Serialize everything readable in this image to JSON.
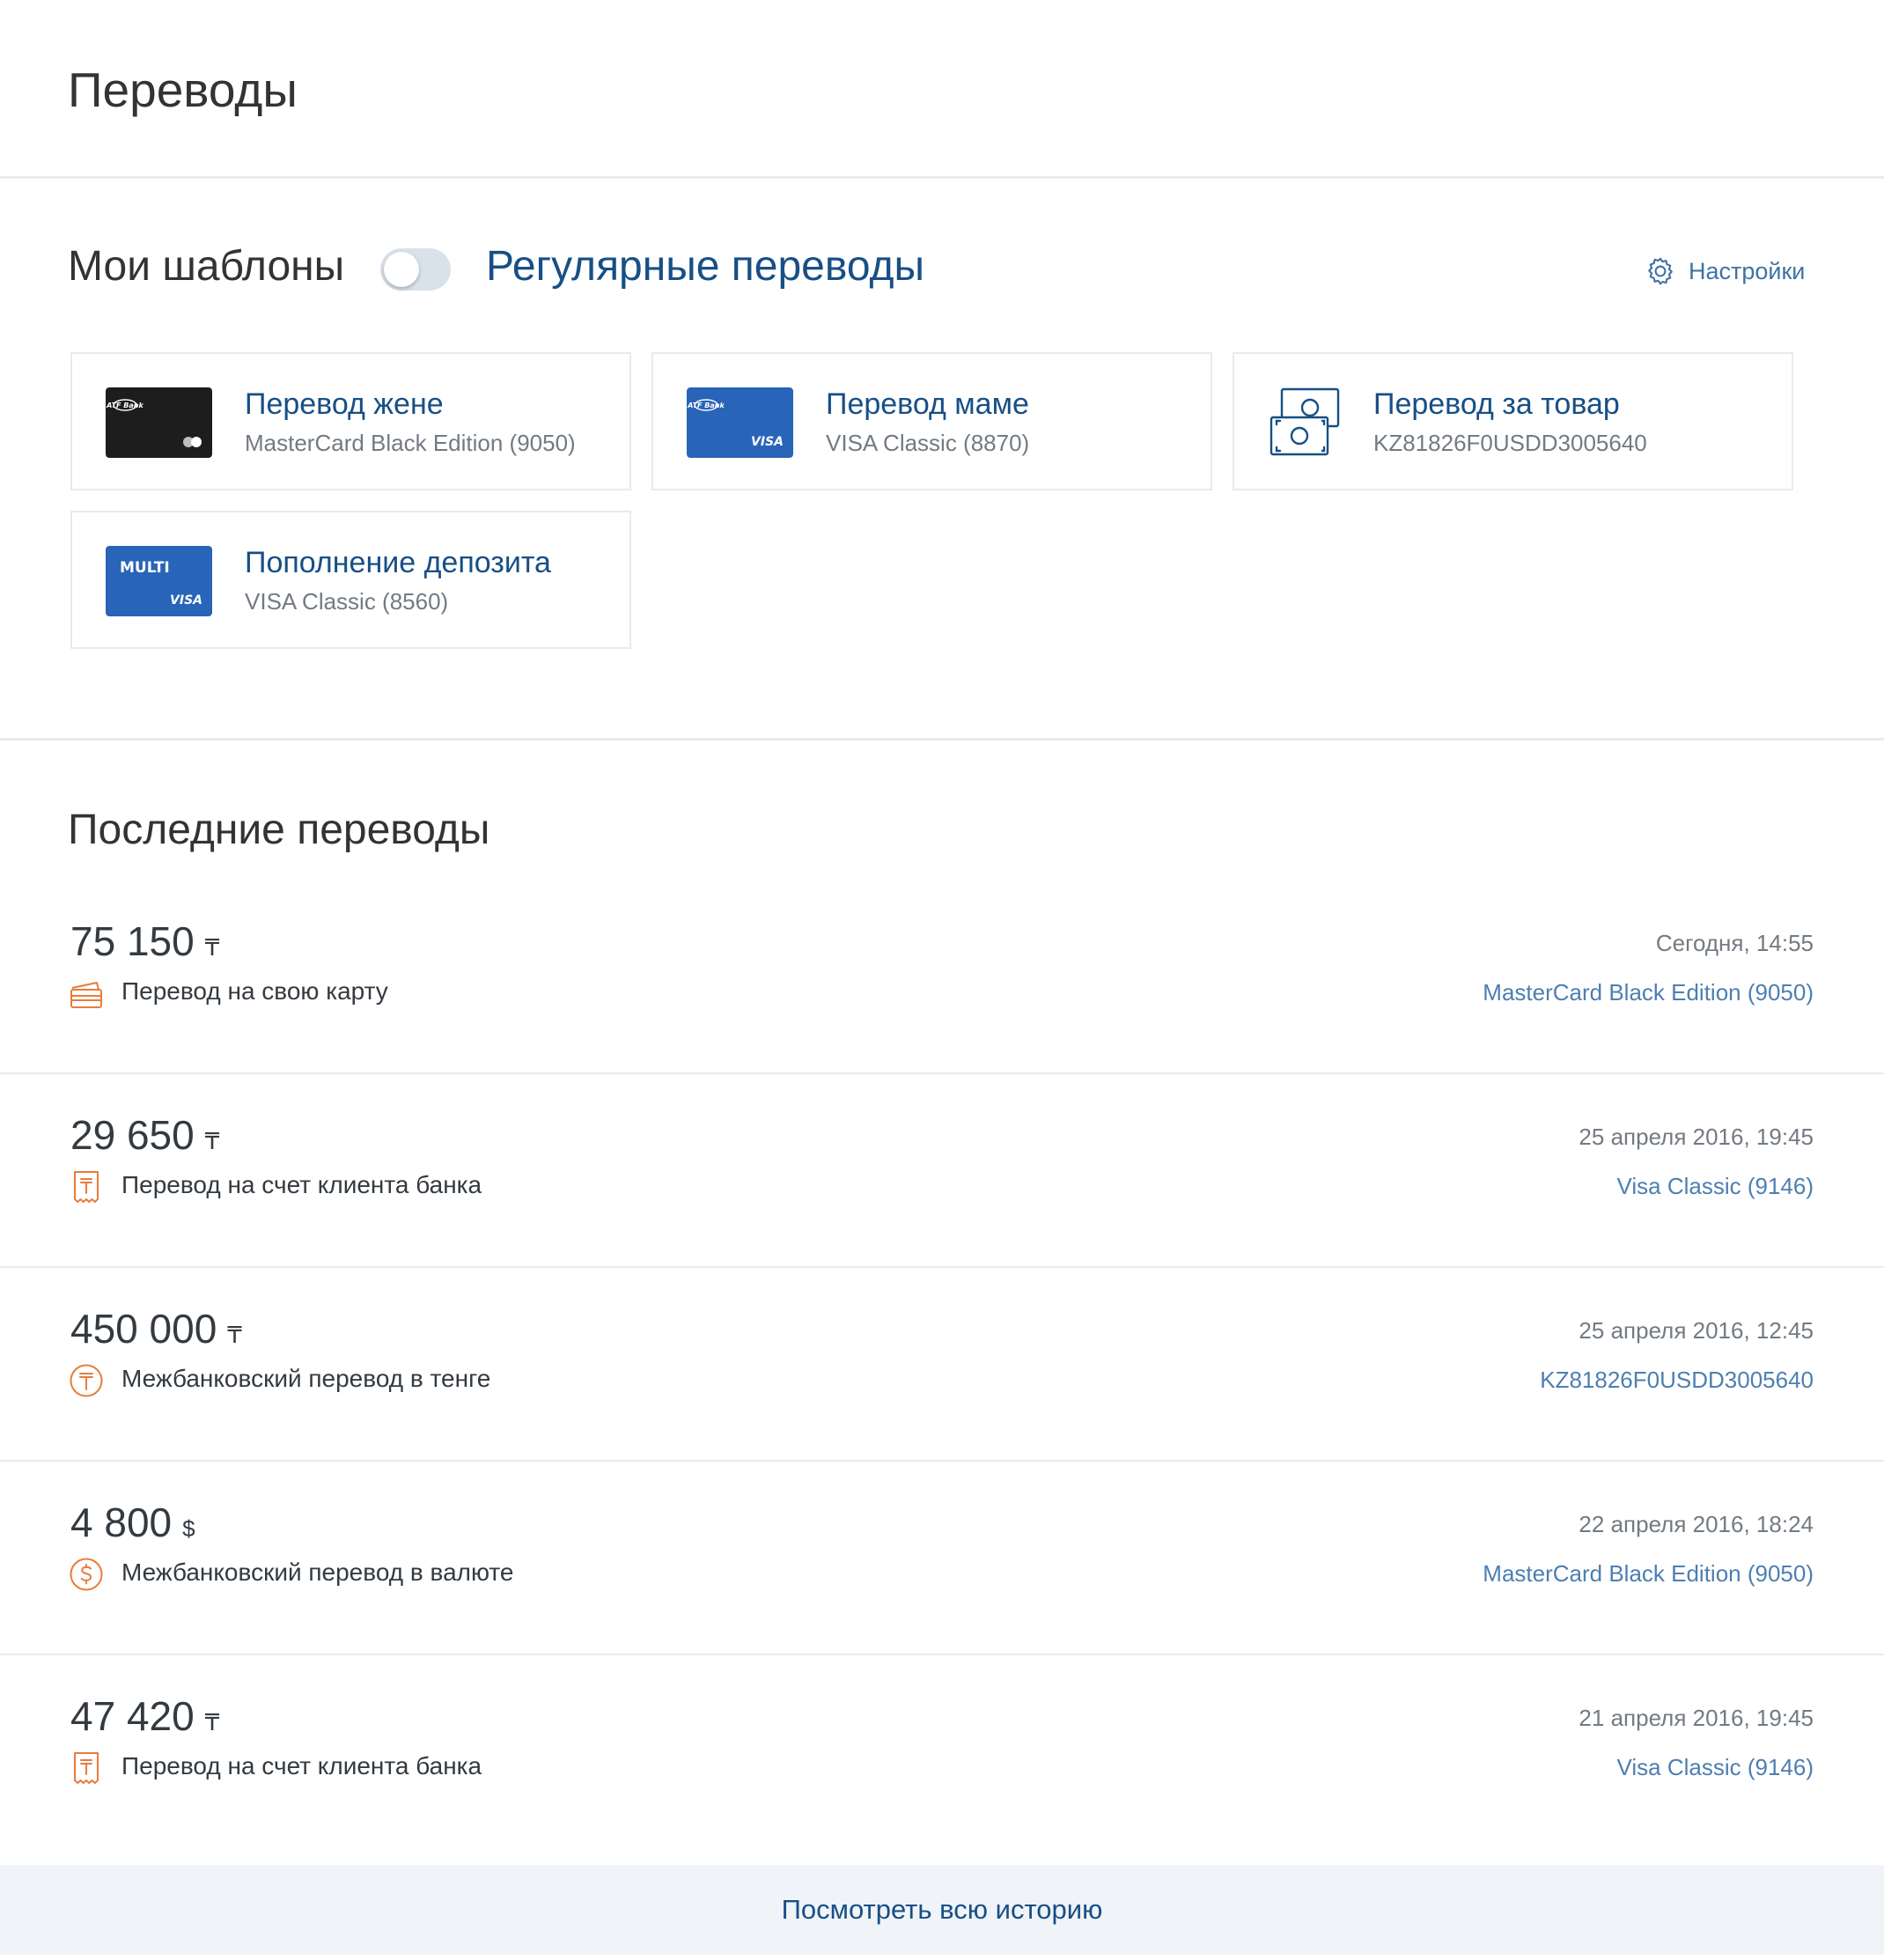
{
  "header": {
    "title": "Переводы"
  },
  "templates": {
    "my_templates_label": "Мои шаблоны",
    "regular_transfers_label": "Регулярные переводы",
    "settings_label": "Настройки",
    "toggle_on": false,
    "items": [
      {
        "title": "Перевод жене",
        "subtitle": "MasterCard Black Edition (9050)",
        "thumb": "atf-black-card",
        "thumb_brand": "ATF Bank"
      },
      {
        "title": "Перевод маме",
        "subtitle": "VISA Classic (8870)",
        "thumb": "atf-visa-card",
        "thumb_brand": "ATF Bank",
        "thumb_network": "VISA"
      },
      {
        "title": "Перевод за товар",
        "subtitle": "KZ81826F0USDD3005640",
        "thumb": "banknotes-icon"
      },
      {
        "title": "Пополнение депозита",
        "subtitle": "VISA Classic (8560)",
        "thumb": "multi-visa-card",
        "thumb_brand": "MULTI",
        "thumb_network": "VISA"
      }
    ]
  },
  "recent": {
    "title": "Последние переводы",
    "items": [
      {
        "amount": "75 150",
        "currency": "₸",
        "type": "Перевод на свою карту",
        "icon": "card-icon",
        "date": "Сегодня, 14:55",
        "account": "MasterCard Black Edition (9050)"
      },
      {
        "amount": "29 650",
        "currency": "₸",
        "type": "Перевод на счет клиента банка",
        "icon": "receipt-tenge-icon",
        "date": "25 апреля 2016, 19:45",
        "account": "Visa Classic (9146)"
      },
      {
        "amount": "450 000",
        "currency": "₸",
        "type": "Межбанковский перевод в тенге",
        "icon": "tenge-coin-icon",
        "date": "25 апреля 2016, 12:45",
        "account": "KZ81826F0USDD3005640"
      },
      {
        "amount": "4 800",
        "currency": "$",
        "type": "Межбанковский перевод в валюте",
        "icon": "dollar-coin-icon",
        "date": "22 апреля 2016, 18:24",
        "account": "MasterCard Black Edition (9050)"
      },
      {
        "amount": "47 420",
        "currency": "₸",
        "type": "Перевод на счет клиента банка",
        "icon": "receipt-tenge-icon",
        "date": "21 апреля 2016, 19:45",
        "account": "Visa Classic (9146)"
      }
    ]
  },
  "footer": {
    "history_link": "Посмотреть всю историю"
  },
  "colors": {
    "accent": "#174f86",
    "link": "#4d7fb1",
    "icon_orange": "#e87c3a",
    "divider": "#e6ebf1",
    "footer_bg": "#f0f3f7"
  }
}
